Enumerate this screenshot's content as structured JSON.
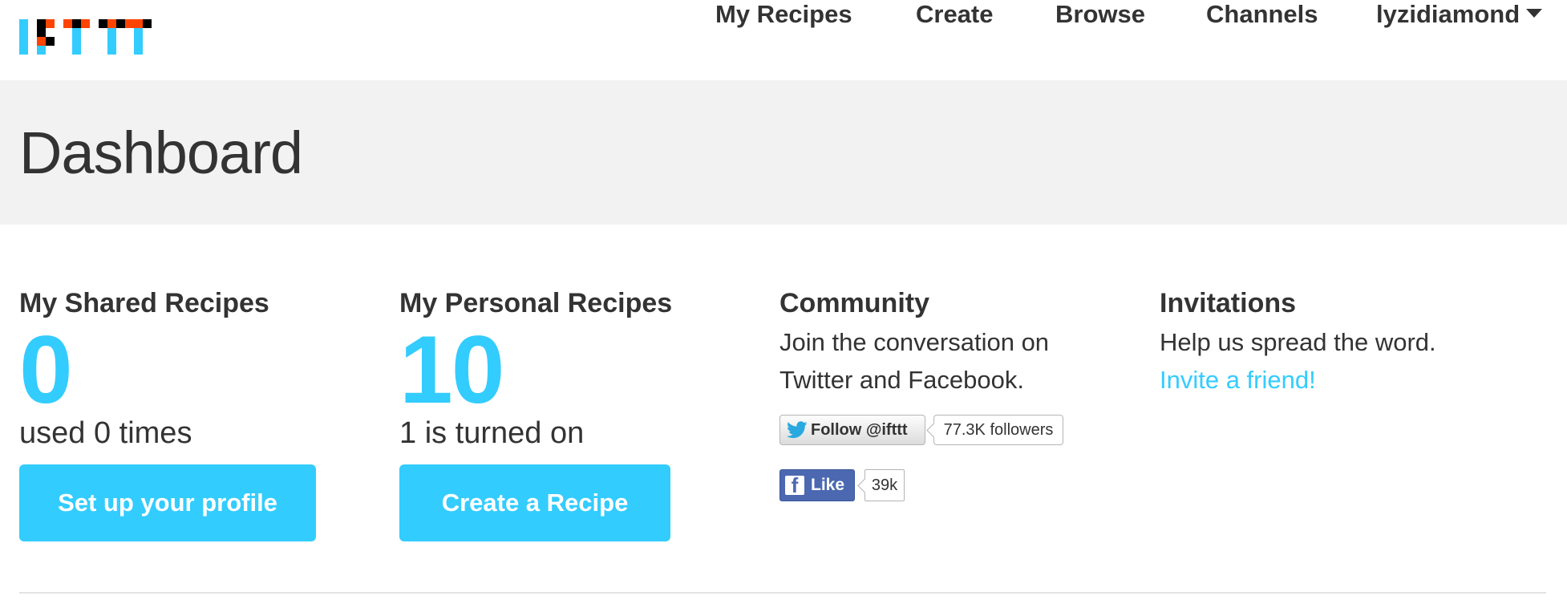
{
  "logo": {
    "text": "IFTTT",
    "colors": {
      "blue": "#33ccff",
      "orange": "#ff4400",
      "black": "#000000"
    }
  },
  "nav": {
    "items": [
      {
        "label": "My Recipes"
      },
      {
        "label": "Create"
      },
      {
        "label": "Browse"
      },
      {
        "label": "Channels"
      }
    ],
    "user": {
      "label": "lyzidiamond",
      "icon": "caret-down-icon"
    }
  },
  "page": {
    "title": "Dashboard"
  },
  "shared": {
    "heading": "My Shared Recipes",
    "count": "0",
    "subtitle": "used 0 times",
    "button_label": "Set up your profile"
  },
  "personal": {
    "heading": "My Personal Recipes",
    "count": "10",
    "subtitle": "1 is turned on",
    "button_label": "Create a Recipe"
  },
  "community": {
    "heading": "Community",
    "text_line1": "Join the conversation on",
    "text_line2": "Twitter and Facebook.",
    "twitter": {
      "button_label": "Follow @ifttt",
      "count": "77.3K followers",
      "icon": "twitter-bird-icon"
    },
    "facebook": {
      "button_label": "Like",
      "count": "39k",
      "icon": "facebook-f-icon"
    }
  },
  "invitations": {
    "heading": "Invitations",
    "text": "Help us spread the word.",
    "link": "Invite a friend!"
  },
  "colors": {
    "accent": "#33ccff",
    "band": "#f2f2f2",
    "text": "#333333",
    "facebook": "#4b68b1"
  }
}
